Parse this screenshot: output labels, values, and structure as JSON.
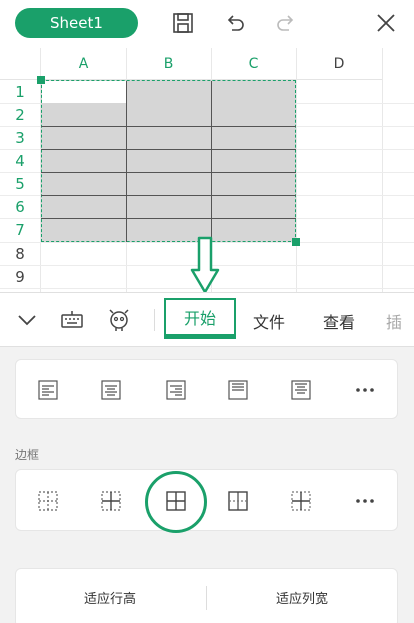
{
  "topbar": {
    "sheet_tab": "Sheet1",
    "icons": [
      "save-icon",
      "undo-icon",
      "redo-icon",
      "close-icon"
    ]
  },
  "grid": {
    "columns": [
      "A",
      "B",
      "C",
      "D"
    ],
    "rows": [
      "1",
      "2",
      "3",
      "4",
      "5",
      "6",
      "7",
      "8",
      "9"
    ]
  },
  "tabs": {
    "items": [
      "开始",
      "文件",
      "查看",
      "插"
    ],
    "active": "开始",
    "icons": [
      "chevron-down-icon",
      "keyboard-icon",
      "mascot-icon"
    ]
  },
  "panel": {
    "border_section_label": "边框",
    "align_icons": [
      "align-left-icon",
      "align-center-icon",
      "align-right-icon",
      "align-top-icon",
      "align-middle-icon",
      "more-icon"
    ],
    "border_icons": [
      "border-none-icon",
      "border-inner-icon",
      "border-all-icon",
      "border-outer-icon",
      "border-vertical-icon",
      "more-icon"
    ],
    "fit_row_height": "适应行高",
    "fit_col_width": "适应列宽"
  },
  "colors": {
    "accent": "#1aa06a",
    "selection_fill": "#d6d6d6",
    "panel_bg": "#f2f2f2"
  }
}
